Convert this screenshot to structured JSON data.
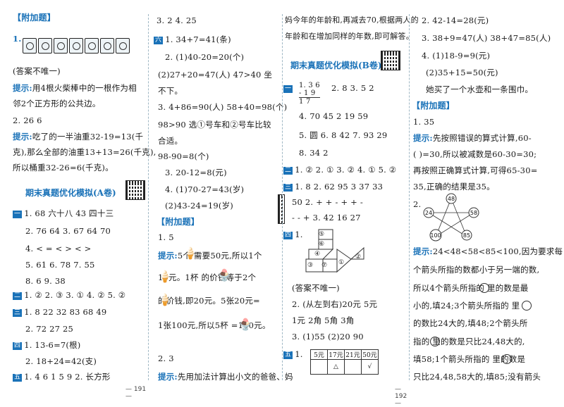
{
  "pages": {
    "left": "— 191 —",
    "right": "— 192 —"
  },
  "col1": {
    "fujia_title": "【附加题】",
    "q1_label": "1.",
    "note1": "(答案不唯一)",
    "tip_label": "提示:",
    "tip1_a": "用4根火柴棒中的一根作为相",
    "tip1_b": "邻2个正方形的公共边。",
    "q2": "2. 26   6",
    "tip2_a": "吃了的一半油重32-19=13(千",
    "tip2_b": "克),那么全部的油重13+13=26(千克),",
    "tip2_c": "所以桶重32-26=6(千克)。",
    "sec_a_title": "期末真题优化模拟(A卷)",
    "one_mark": "一",
    "one_1": "1. 68  六十八  43  四十三",
    "one_2": "2. 76  64  3. 67  64  70",
    "one_4": "4. <   =   <   >   <   >",
    "one_5": "5. 61   6. 78   7. 55",
    "one_8": "8. 6   9. 38",
    "two_mark": "二",
    "two_1": "1. ②   2. ③   3. ①   4. ②   5. ②",
    "three_mark": "三",
    "three_1": "1. 8   22   32   83   68   49",
    "three_2": "2. 72   27   25",
    "four_mark": "四",
    "four_1": "1. 13-6=7(根)",
    "four_2": "2. 18+24=42(支)",
    "five_mark": "五",
    "five_1": "1. 4   6   1   5   9   2. 长方形"
  },
  "col2": {
    "l1": "3. 2   4. 25",
    "six_mark": "六",
    "l2": "1. 34+7=41(条)",
    "l3": "2. (1)40-20=20(个)",
    "l4": "(2)27+20=47(人)   47>40   坐",
    "l5": "不下。",
    "l6": "3. 4+86=90(人)  58+40=98(个)",
    "l7": "98>90   选①号车和②号车比较",
    "l8": "合适。",
    "l9": "98-90=8(个)",
    "l10": "3. 20-12=8(元)",
    "l11": "4. (1)70-27=43(岁)",
    "l12": "(2)43-24=19(岁)",
    "fujia": "【附加题】",
    "l13": "1. 5",
    "tip_label": "提示:",
    "l14": "5个       需要50元,所以1个",
    "l15": "      10元。1杯       的价钱等于2个",
    "l16": "      的价钱,即20元。5张20元=",
    "l17": "1张100元,所以5杯       =100元。",
    "l18": "2. 3",
    "l19": "先用加法计算出小文的爸爸、妈"
  },
  "col3": {
    "l1": "妈今年的年龄和,再减去70,根据两人的",
    "l2": "年龄和在增加同样的年数,即可解答。",
    "sec_b_title": "期末真题优化模拟(B卷)",
    "one_mark": "一",
    "one_1a": "1.  3 6",
    "one_1b": "  - 1 9",
    "one_1c": "    1 7",
    "one_1d": "2. 8   3. 5   2",
    "one_4": "4. 70   45   2   19   59",
    "one_5": "5. 圆   6. 8   42   7. 93   29",
    "one_8": "8. 34   2",
    "two_mark": "二",
    "two_1": "1. ②   2. ①   3. ②   4. ①   5. ②",
    "three_mark": "三",
    "three_1": "1. 8   2. 62   95   3   37   33",
    "three_2": "50   2. +    +    -    +    +    -",
    "three_3": "-    -    +   3. 42   16   27",
    "four_mark": "四",
    "four_1": "1.",
    "tangram": [
      "⑤",
      "⑥",
      "④",
      "③",
      "⑦",
      "①",
      "②"
    ],
    "note": "(答案不唯一)",
    "four_2": "2. (从左到右)20元   5元",
    "four_3": "1元 2角   5角   3角",
    "four_4": "3. (1)55   (2)20   90",
    "five_mark": "五",
    "five_1": "1.",
    "table_head": [
      "5元",
      "17元",
      "21元",
      "50元"
    ],
    "table_row": [
      "",
      "△",
      "",
      "√"
    ]
  },
  "col4": {
    "l1": "2. 42-14=28(元)",
    "l2": "3. 38+9=47(人)   38+47=85(人)",
    "l3": "4. (1)18-9=9(元)",
    "l4": "(2)35+15=50(元)",
    "l5": "她买了一个水壶和一条围巾。",
    "fujia": "【附加题】",
    "l6": "1. 35",
    "tip_label": "提示:",
    "l7": "先按照错误的算式计算,60-",
    "l8": "(     )=30,所以被减数是60-30=30;",
    "l9": "再按照正确算式计算,可得65-30=",
    "l10": "35,正确的结果是35。",
    "l11": "2.",
    "star_nums": [
      "48",
      "24",
      "58",
      "100",
      "85"
    ],
    "l12": "24<48<58<85<100,因为要求每",
    "l13": "个箭头所指的数都小于另一端的数,",
    "l14": "所以4个箭头所指的      里的数是最",
    "l15": "小的,填24;3个箭头所指的      里",
    "l16": "的数比24大的,填48;2个箭头所",
    "l17": "指的      里的数是只比24,48大的,",
    "l18": "填58;1个箭头所指的      里的数是",
    "l19": "只比24,48,58大的,填85;没有箭头"
  }
}
